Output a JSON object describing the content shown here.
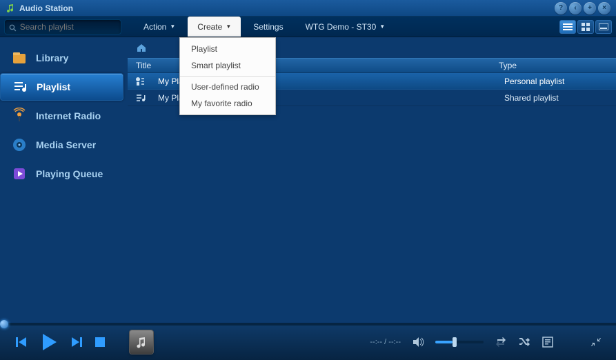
{
  "title": "Audio Station",
  "search_placeholder": "Search playlist",
  "toolbar": {
    "action": "Action",
    "create": "Create",
    "settings": "Settings",
    "device": "WTG Demo - ST30"
  },
  "create_menu": {
    "playlist": "Playlist",
    "smart": "Smart playlist",
    "udr": "User-defined radio",
    "fav": "My favorite radio"
  },
  "sidebar": {
    "library": "Library",
    "playlist": "Playlist",
    "radio": "Internet Radio",
    "mserver": "Media Server",
    "queue": "Playing Queue"
  },
  "table": {
    "col_title": "Title",
    "col_type": "Type",
    "rows": [
      {
        "title": "My Playlist",
        "type": "Personal playlist"
      },
      {
        "title": "My Playlist 2",
        "type": "Shared playlist"
      }
    ]
  },
  "player": {
    "time": "--:-- / --:--"
  }
}
